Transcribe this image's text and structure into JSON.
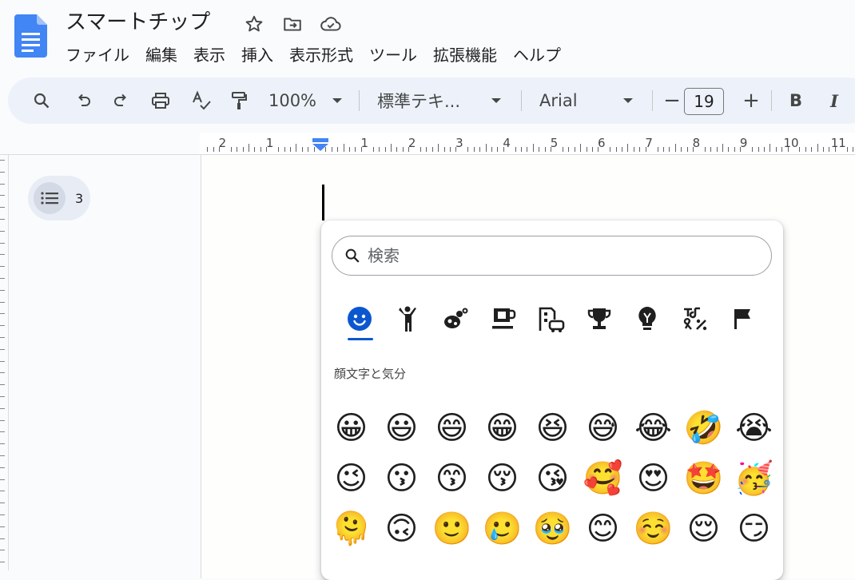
{
  "header": {
    "title": "スマートチップ",
    "icons": [
      "star-icon",
      "move-to-folder-icon",
      "cloud-saved-icon"
    ]
  },
  "menu": [
    "ファイル",
    "編集",
    "表示",
    "挿入",
    "表示形式",
    "ツール",
    "拡張機能",
    "ヘルプ"
  ],
  "toolbar": {
    "zoom": "100%",
    "style": "標準テキ...",
    "font": "Arial",
    "font_size": "19",
    "bold_label": "B",
    "italic_label": "I",
    "minus_label": "−",
    "plus_label": "+"
  },
  "ruler": {
    "numbers": [
      "2",
      "1",
      "1",
      "2",
      "3",
      "4",
      "5",
      "6",
      "7",
      "8",
      "9",
      "10",
      "11"
    ]
  },
  "outline": {
    "count": "3"
  },
  "emoji_picker": {
    "search_placeholder": "検索",
    "categories": [
      "smiley-icon",
      "person-icon",
      "animals-nature-icon",
      "food-drink-icon",
      "travel-places-icon",
      "activities-trophy-icon",
      "objects-lightbulb-icon",
      "symbols-icon",
      "flags-icon"
    ],
    "active_category": 0,
    "section_title": "顔文字と気分",
    "emojis": [
      "😀",
      "😃",
      "😄",
      "😁",
      "😆",
      "😅",
      "😂",
      "🤣",
      "😭",
      "😉",
      "😗",
      "😙",
      "😚",
      "😘",
      "🥰",
      "😍",
      "🤩",
      "🥳",
      "🫠",
      "🙃",
      "🙂",
      "🥲",
      "🥹",
      "😊",
      "☺️",
      "😌",
      "😏"
    ]
  },
  "colors": {
    "accent": "#0b57d0",
    "docs_blue": "#4285f4",
    "toolbar_bg": "#edf2fa",
    "emoji_yellow": "#f8c22a"
  }
}
